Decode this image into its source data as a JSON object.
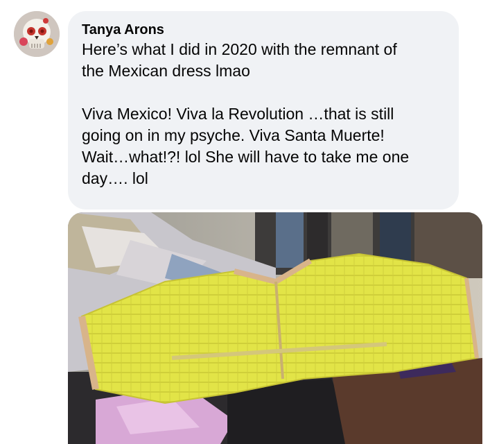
{
  "comment": {
    "author": "Tanya Arons",
    "lines": [
      "Here’s  what I did in 2020 with the remnant of",
      "the Mexican dress lmao",
      "",
      "Viva Mexico! Viva la Revolution …that is still",
      "going on in my psyche.  Viva Santa Muerte!",
      "Wait…what!?! lol She will have to take me one",
      "day…. lol"
    ]
  },
  "colors": {
    "bubble": "#f0f2f5",
    "text": "#050505",
    "pillow_yellow": "#e4e64a"
  },
  "icons": {
    "avatar": "skull-avatar-icon"
  }
}
